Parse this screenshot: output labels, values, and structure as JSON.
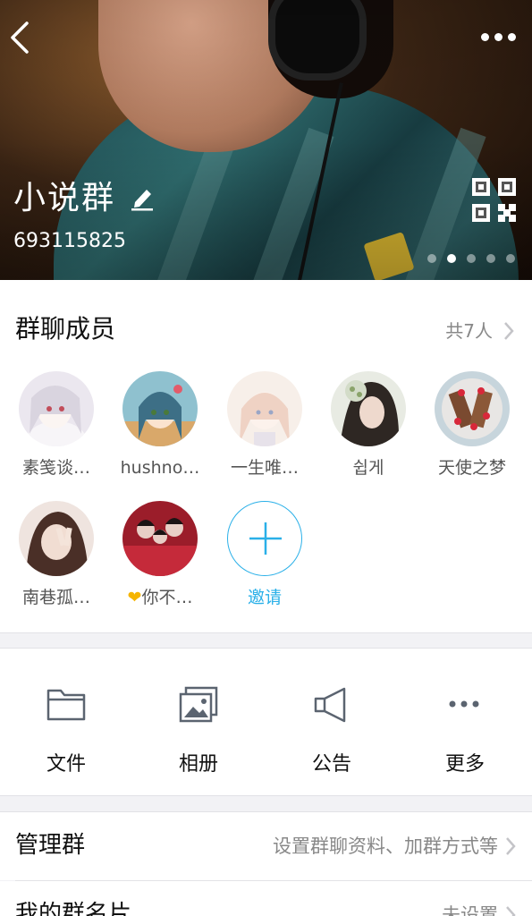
{
  "header": {
    "group_name": "小说群",
    "group_id": "693115825",
    "page_dots_count": 5,
    "active_page_dot": 2
  },
  "members_section": {
    "title": "群聊成员",
    "count_label": "共7人",
    "members": [
      {
        "name": "素笺谈…",
        "avatar_colors": [
          "#e9e6ee",
          "#cfc6d8"
        ]
      },
      {
        "name": "hushno…",
        "avatar_colors": [
          "#7fb6c7",
          "#e0a867"
        ]
      },
      {
        "name": "一生唯…",
        "avatar_colors": [
          "#f6ede6",
          "#e9c9c0"
        ]
      },
      {
        "name": "쉽게",
        "avatar_colors": [
          "#e9ece4",
          "#2b2622"
        ]
      },
      {
        "name": "天使之梦",
        "avatar_colors": [
          "#c9d7dd",
          "#8a3c2e"
        ]
      },
      {
        "name": "南巷孤…",
        "avatar_colors": [
          "#efe1dc",
          "#4b2f28"
        ]
      },
      {
        "name": "你不…",
        "name_prefix_icon": "heart-icon",
        "heart_glyph": "❤",
        "avatar_colors": [
          "#b82634",
          "#2a1a1a"
        ]
      }
    ],
    "invite_label": "邀请"
  },
  "tools": [
    {
      "label": "文件",
      "icon": "folder-icon"
    },
    {
      "label": "相册",
      "icon": "album-icon"
    },
    {
      "label": "公告",
      "icon": "megaphone-icon"
    },
    {
      "label": "更多",
      "icon": "more-dots-icon"
    }
  ],
  "rows": [
    {
      "title": "管理群",
      "value": "设置群聊资料、加群方式等"
    },
    {
      "title": "我的群名片",
      "value": "未设置"
    }
  ],
  "colors": {
    "accent": "#2ab0e8",
    "secondary_text": "#888888",
    "page_background": "#f2f2f5",
    "heart": "#f5b400"
  }
}
